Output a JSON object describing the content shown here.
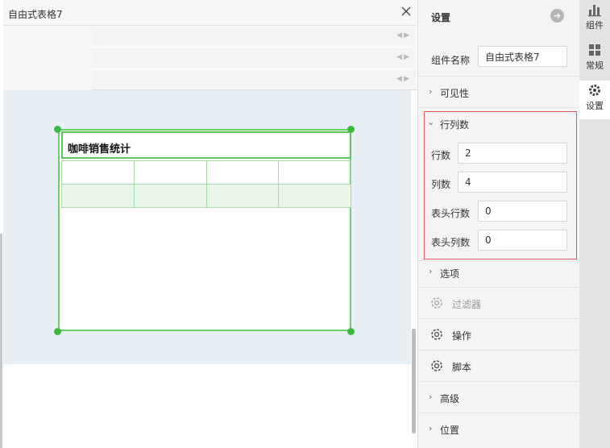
{
  "editor": {
    "title": "自由式表格7"
  },
  "widget": {
    "title": "咖啡销售统计"
  },
  "settings": {
    "title": "设置",
    "name_label": "组件名称",
    "name_value": "自由式表格7",
    "sections": {
      "visibility": "可见性",
      "rowcol": "行列数",
      "options": "选项",
      "filter": "过滤器",
      "action": "操作",
      "script": "脚本",
      "advanced": "高级",
      "position": "位置"
    },
    "rowcol": {
      "rows_label": "行数",
      "rows_value": "2",
      "cols_label": "列数",
      "cols_value": "4",
      "header_rows_label": "表头行数",
      "header_rows_value": "0",
      "header_cols_label": "表头列数",
      "header_cols_value": "0"
    }
  },
  "rail": {
    "tabs": [
      {
        "label": "组件",
        "icon": "bar-chart-icon"
      },
      {
        "label": "常规",
        "icon": "grid-icon"
      },
      {
        "label": "设置",
        "icon": "gear-icon"
      }
    ]
  }
}
